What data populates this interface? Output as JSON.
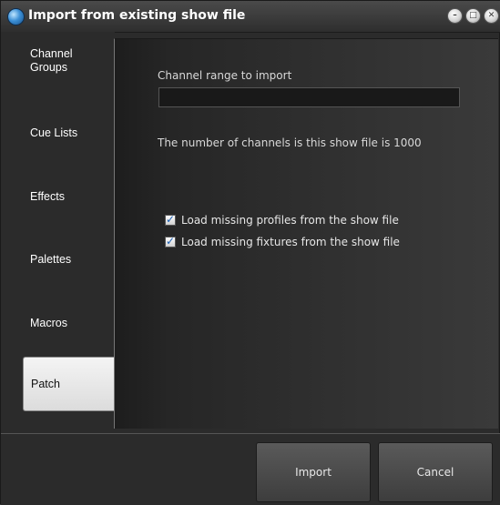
{
  "window": {
    "title": "Import from existing show file"
  },
  "tabs": [
    {
      "label": "Channel\nGroups"
    },
    {
      "label": "Cue Lists"
    },
    {
      "label": "Effects"
    },
    {
      "label": "Palettes"
    },
    {
      "label": "Macros"
    },
    {
      "label": "Patch"
    }
  ],
  "panel": {
    "range_label": "Channel range to import",
    "range_value": "",
    "info": "The number of channels is this show file is 1000",
    "check_profiles": {
      "label": "Load missing profiles from the show file",
      "checked": true
    },
    "check_fixtures": {
      "label": "Load missing fixtures from the show file",
      "checked": true
    }
  },
  "buttons": {
    "import": "Import",
    "cancel": "Cancel"
  },
  "icons": {
    "app": "app-globe-icon",
    "minimize": "minimize-icon",
    "maximize": "maximize-icon",
    "close": "close-icon"
  }
}
